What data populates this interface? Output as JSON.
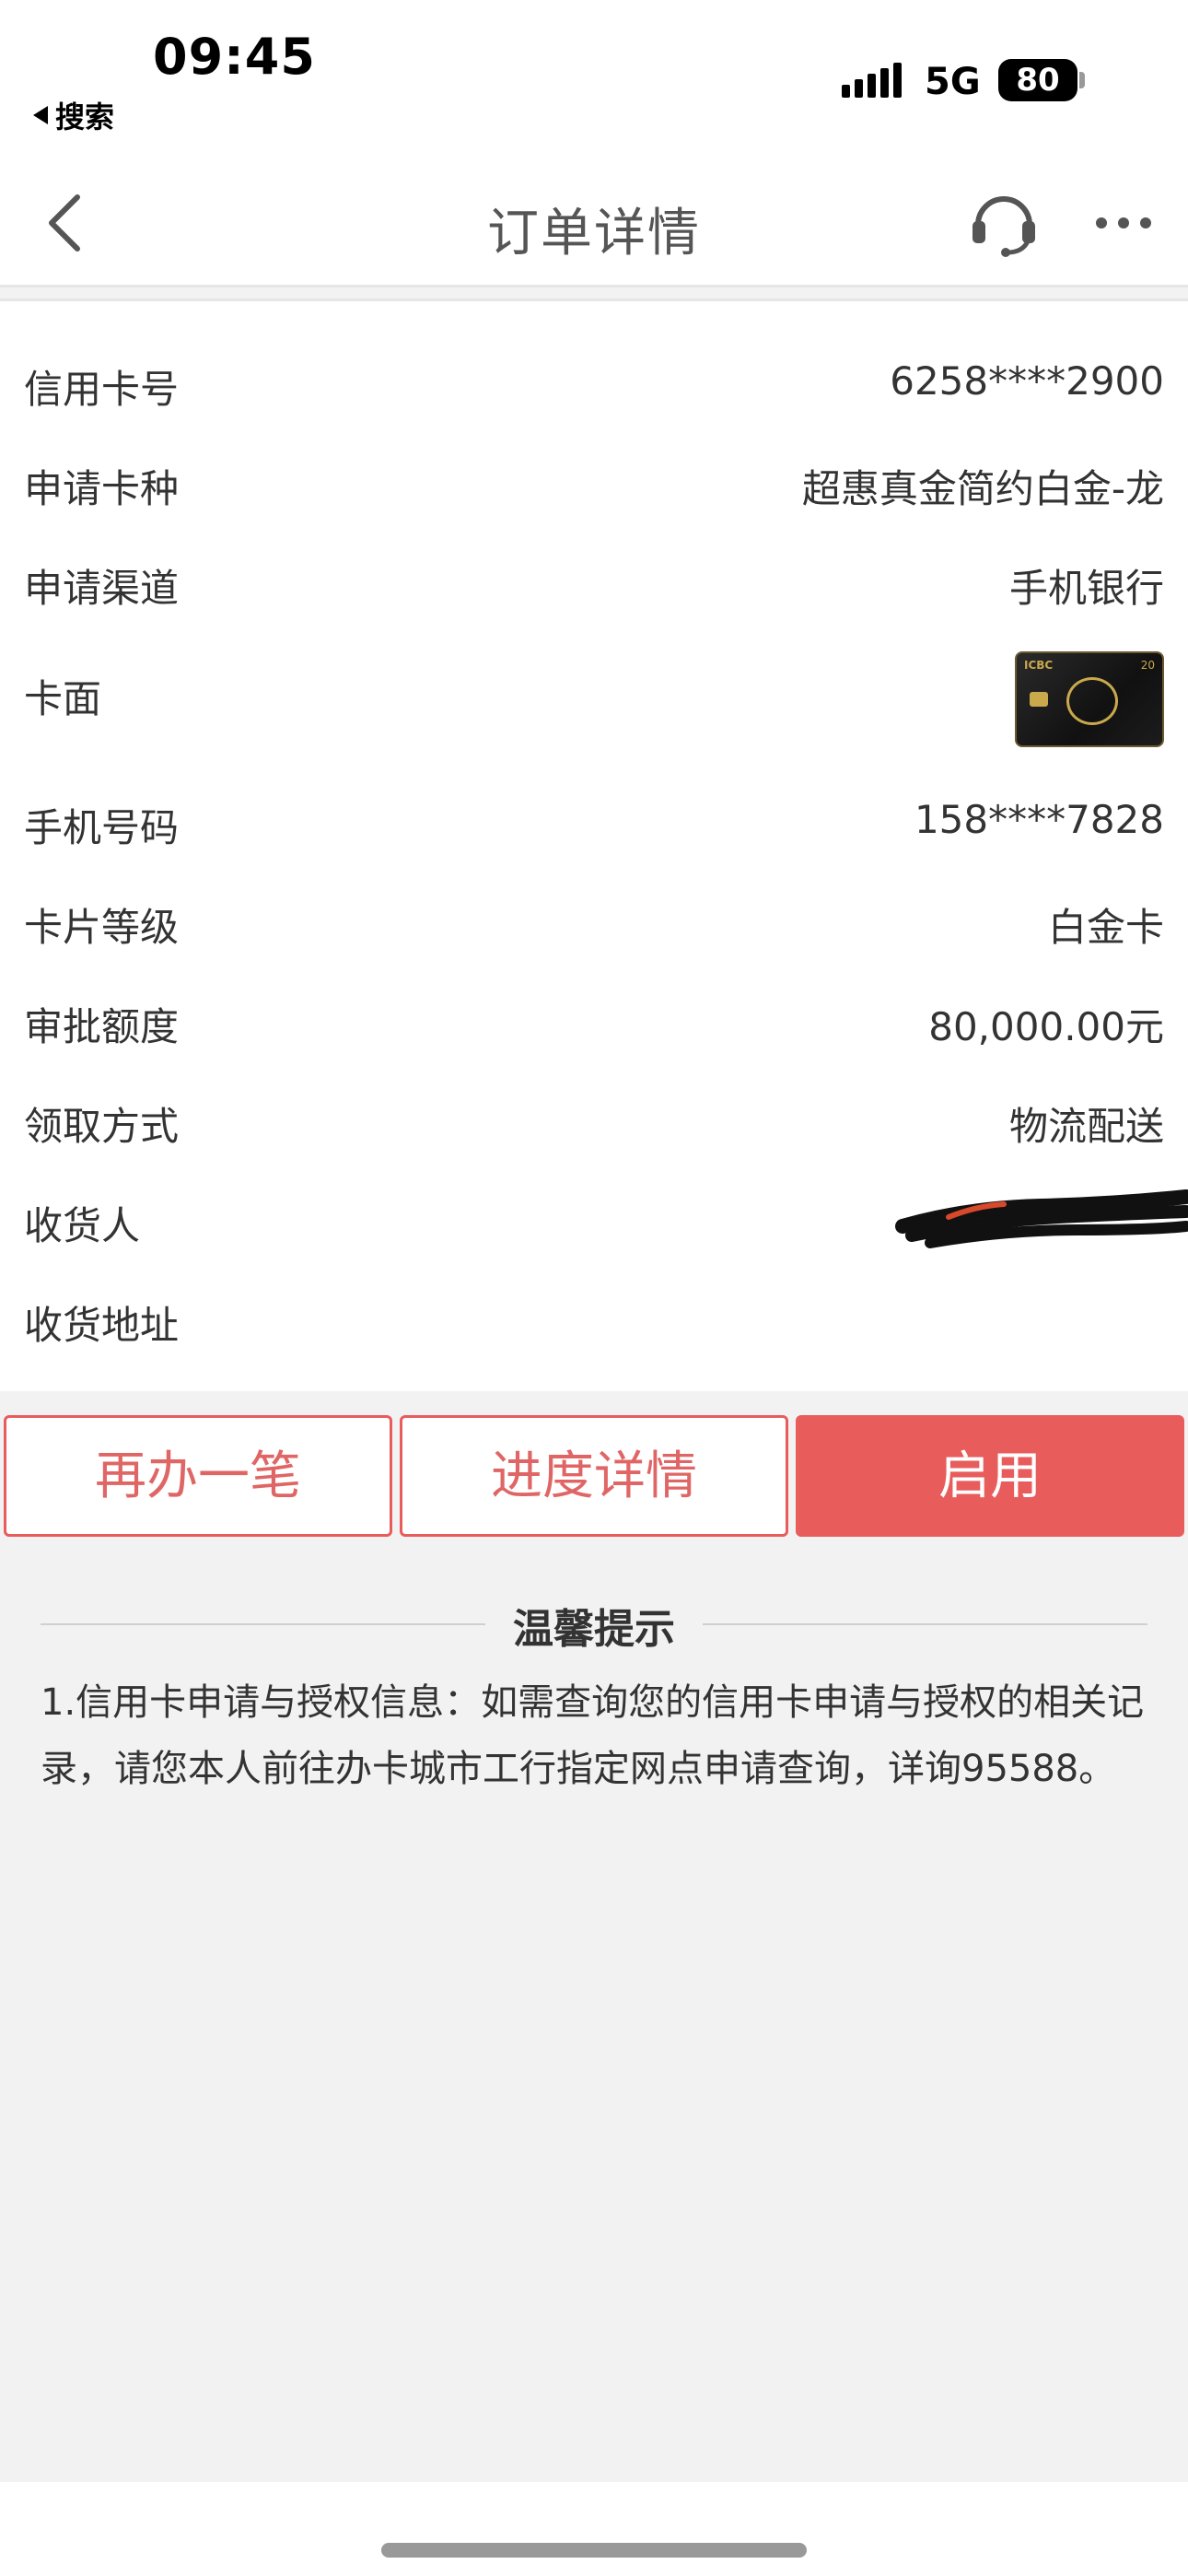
{
  "status_bar": {
    "time": "09:45",
    "back_app": "搜索",
    "network": "5G",
    "battery": "80",
    "icons": [
      "signal-icon",
      "battery-icon",
      "back-triangle-icon"
    ]
  },
  "nav": {
    "title": "订单详情",
    "icons": [
      "back-chevron-icon",
      "headset-icon",
      "more-dots-icon"
    ]
  },
  "details": [
    {
      "label": "信用卡号",
      "value": "6258****2900"
    },
    {
      "label": "申请卡种",
      "value": "超惠真金简约白金-龙"
    },
    {
      "label": "申请渠道",
      "value": "手机银行"
    },
    {
      "label": "卡面",
      "value": ""
    },
    {
      "label": "手机号码",
      "value": "158****7828"
    },
    {
      "label": "卡片等级",
      "value": "白金卡"
    },
    {
      "label": "审批额度",
      "value": "80,000.00元"
    },
    {
      "label": "领取方式",
      "value": "物流配送"
    },
    {
      "label": "收货人",
      "value": ""
    },
    {
      "label": "收货地址",
      "value": ""
    }
  ],
  "buttons": {
    "reapply": "再办一笔",
    "progress": "进度详情",
    "activate": "启用"
  },
  "tips": {
    "title": "温馨提示",
    "body": "1.信用卡申请与授权信息：如需查询您的信用卡申请与授权的相关记录，请您本人前往办卡城市工行指定网点申请查询，详询95588。"
  },
  "colors": {
    "accent": "#e85c5c",
    "background": "#f2f2f2",
    "card_gold": "#c9a94c"
  }
}
